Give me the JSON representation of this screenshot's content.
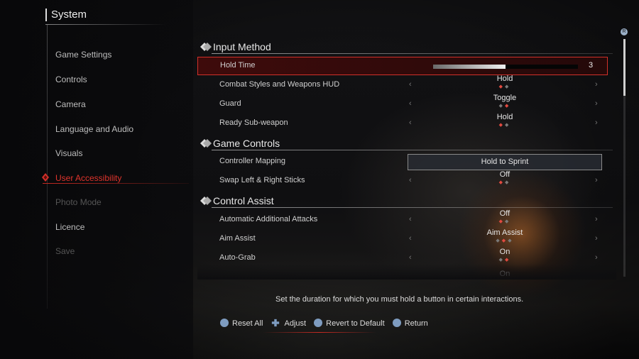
{
  "title": "System",
  "nav": {
    "items": [
      {
        "label": "Game Settings",
        "state": "normal"
      },
      {
        "label": "Controls",
        "state": "normal"
      },
      {
        "label": "Camera",
        "state": "normal"
      },
      {
        "label": "Language and Audio",
        "state": "normal"
      },
      {
        "label": "Visuals",
        "state": "normal"
      },
      {
        "label": "User Accessibility",
        "state": "active"
      },
      {
        "label": "Photo Mode",
        "state": "disabled"
      },
      {
        "label": "Licence",
        "state": "normal"
      },
      {
        "label": "Save",
        "state": "disabled"
      }
    ]
  },
  "sections": {
    "input_method": {
      "title": "Input Method",
      "hold_time": {
        "label": "Hold Time",
        "value": "3",
        "fill_fraction": 0.5
      },
      "combat_hud": {
        "label": "Combat Styles and Weapons HUD",
        "value": "Hold",
        "option_count": 2,
        "selected_index": 0
      },
      "guard": {
        "label": "Guard",
        "value": "Toggle",
        "option_count": 2,
        "selected_index": 1
      },
      "ready_sub": {
        "label": "Ready Sub-weapon",
        "value": "Hold",
        "option_count": 2,
        "selected_index": 0
      }
    },
    "game_controls": {
      "title": "Game Controls",
      "controller_mapping": {
        "label": "Controller Mapping",
        "value": "Hold to Sprint"
      },
      "swap_sticks": {
        "label": "Swap Left & Right Sticks",
        "value": "Off",
        "option_count": 2,
        "selected_index": 0
      }
    },
    "control_assist": {
      "title": "Control Assist",
      "auto_attacks": {
        "label": "Automatic Additional Attacks",
        "value": "Off",
        "option_count": 2,
        "selected_index": 0
      },
      "aim_assist": {
        "label": "Aim Assist",
        "value": "Aim Assist",
        "option_count": 3,
        "selected_index": 1
      },
      "auto_grab": {
        "label": "Auto-Grab",
        "value": "On",
        "option_count": 2,
        "selected_index": 1
      },
      "partial_value": "On"
    }
  },
  "help_text": "Set the duration for which you must hold a button in certain interactions.",
  "footer": {
    "reset_all": "Reset All",
    "adjust": "Adjust",
    "revert": "Revert to Default",
    "return": "Return"
  },
  "chevron_left": "‹",
  "chevron_right": "›",
  "colors": {
    "accent": "#d2302a",
    "highlight_bg": "#3a0a0a"
  }
}
